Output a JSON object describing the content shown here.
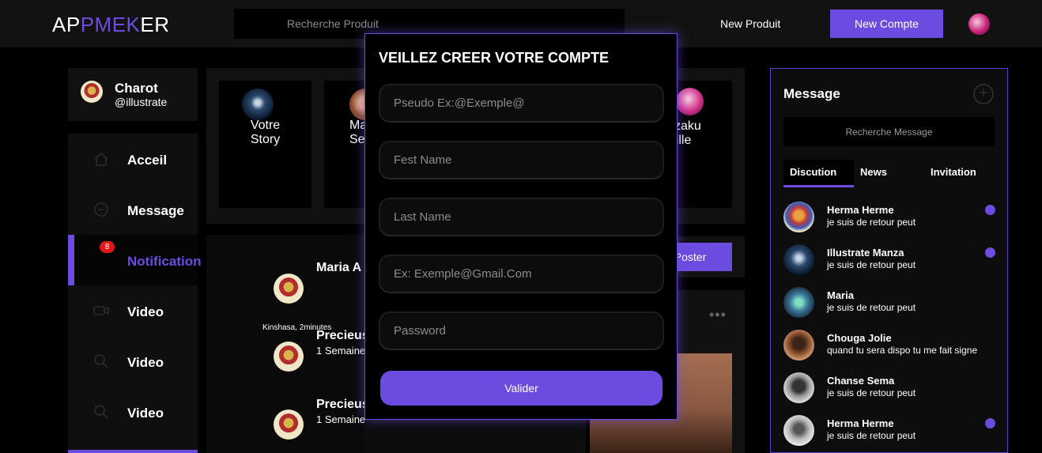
{
  "header": {
    "logo": {
      "part1": "AP",
      "part2": "PMEK",
      "part3": "ER"
    },
    "search_placeholder": "Recherche Produit",
    "new_produit": "New Produit",
    "new_compte": "New Compte"
  },
  "profile": {
    "name": "Charot",
    "handle": "@illustrate"
  },
  "nav": {
    "items": [
      {
        "label": "Acceil",
        "icon": "home-icon"
      },
      {
        "label": "Message",
        "icon": "message-icon"
      },
      {
        "label": "Notification",
        "icon": "bell-icon",
        "badge": "8"
      },
      {
        "label": "Video",
        "icon": "video-icon"
      },
      {
        "label": "Video",
        "icon": "search-icon"
      },
      {
        "label": "Video",
        "icon": "search-icon"
      }
    ]
  },
  "stories": [
    {
      "name": "Votre\nStory"
    },
    {
      "name": "Ma\nSe"
    },
    {
      "name": "Salazaku\nCamille"
    }
  ],
  "feed": {
    "poster": "Poster",
    "posts": [
      {
        "name": "Maria A",
        "meta": "Kinshasa, 2minutes"
      },
      {
        "name": "Precieus",
        "sub": "1 Semaine"
      },
      {
        "name": "Precieus",
        "sub": "1 Semaine"
      }
    ],
    "more": "•••"
  },
  "messages": {
    "title": "Message",
    "plus": "+",
    "search_placeholder": "Recherche Message",
    "tabs": [
      "Discution",
      "News",
      "Invitation"
    ],
    "items": [
      {
        "name": "Herma Herme",
        "text": "je suis de retour peut",
        "unread": true
      },
      {
        "name": "Illustrate Manza",
        "text": "je suis de retour peut",
        "unread": true
      },
      {
        "name": "Maria",
        "text": "je suis de retour peut",
        "unread": false
      },
      {
        "name": "Chouga Jolie",
        "text": "quand tu sera dispo tu me fait signe",
        "unread": false
      },
      {
        "name": "Chanse Sema",
        "text": "je suis de retour peut",
        "unread": false
      },
      {
        "name": "Herma Herme",
        "text": "je suis de retour peut",
        "unread": true
      }
    ]
  },
  "modal": {
    "title": "VEILLEZ CREER VOTRE COMPTE",
    "fields": [
      {
        "placeholder": "Pseudo Ex:@Exemple@"
      },
      {
        "placeholder": "Fest Name"
      },
      {
        "placeholder": "Last Name"
      },
      {
        "placeholder": "Ex: Exemple@Gmail.Com"
      },
      {
        "placeholder": "Password"
      }
    ],
    "submit": "Valider"
  },
  "colors": {
    "accent": "#6c4ce0",
    "badge": "#e01818",
    "background": "#000000",
    "panel": "#111111"
  }
}
